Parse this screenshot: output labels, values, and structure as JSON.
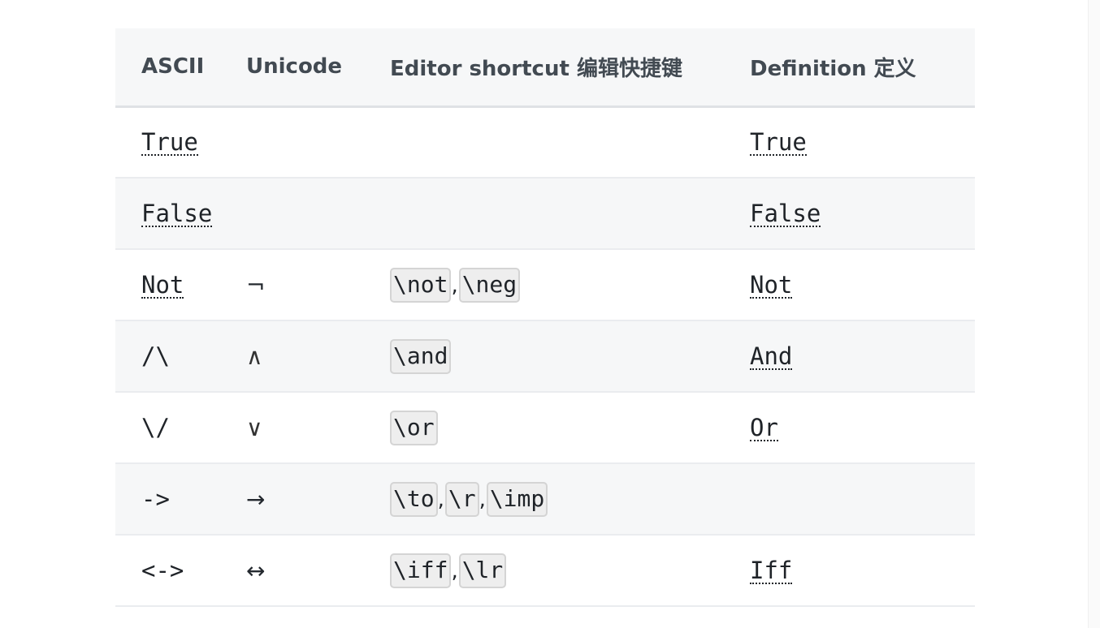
{
  "table": {
    "headers": {
      "ascii": "ASCII",
      "unicode": "Unicode",
      "shortcut": "Editor shortcut  编辑快捷键",
      "definition": "Definition  定义"
    },
    "rows": [
      {
        "ascii": "True",
        "unicode": "",
        "shortcuts": [],
        "definition": "True"
      },
      {
        "ascii": "False",
        "unicode": "",
        "shortcuts": [],
        "definition": "False"
      },
      {
        "ascii": "Not",
        "unicode": "¬",
        "shortcuts": [
          "\\not",
          "\\neg"
        ],
        "definition": "Not"
      },
      {
        "ascii": "/\\",
        "unicode": "∧",
        "shortcuts": [
          "\\and"
        ],
        "definition": "And"
      },
      {
        "ascii": "\\/",
        "unicode": "∨",
        "shortcuts": [
          "\\or"
        ],
        "definition": "Or"
      },
      {
        "ascii": "->",
        "unicode": "→",
        "shortcuts": [
          "\\to",
          "\\r",
          "\\imp"
        ],
        "definition": ""
      },
      {
        "ascii": "<->",
        "unicode": "↔",
        "shortcuts": [
          "\\iff",
          "\\lr"
        ],
        "definition": "Iff"
      }
    ]
  }
}
